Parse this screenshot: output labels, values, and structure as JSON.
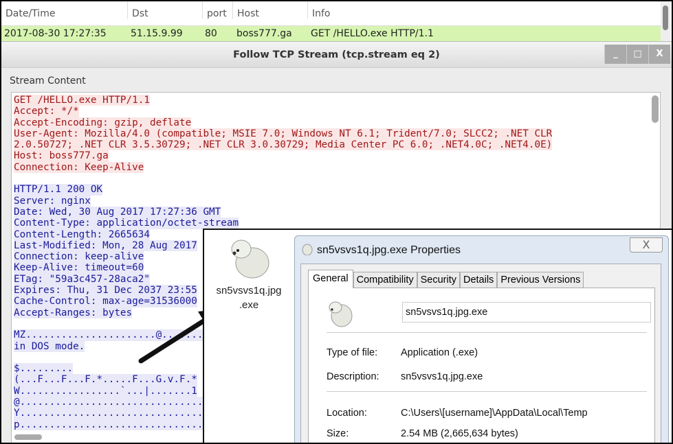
{
  "packet_list": {
    "columns": [
      "Date/Time",
      "Dst",
      "port",
      "Host",
      "Info"
    ],
    "row": [
      "2017-08-30 17:27:35",
      "51.15.9.99",
      "80",
      "boss777.ga",
      "GET /HELLO.exe HTTP/1.1"
    ],
    "row_color": "#d7f5b0"
  },
  "tcp_window": {
    "title": "Follow TCP Stream (tcp.stream eq 2)",
    "buttons": [
      "_",
      "□",
      "X"
    ],
    "stream_label": "Stream Content",
    "client_lines": [
      "GET /HELLO.exe HTTP/1.1",
      "Accept: */*",
      "Accept-Encoding: gzip, deflate",
      "User-Agent: Mozilla/4.0 (compatible; MSIE 7.0; Windows NT 6.1; Trident/7.0; SLCC2; .NET CLR",
      "2.0.50727; .NET CLR 3.5.30729; .NET CLR 3.0.30729; Media Center PC 6.0; .NET4.0C; .NET4.0E)",
      "Host: boss777.ga",
      "Connection: Keep-Alive"
    ],
    "server_lines": [
      "HTTP/1.1 200 OK",
      "Server: nginx",
      "Date: Wed, 30 Aug 2017 17:27:36 GMT",
      "Content-Type: application/octet-stream",
      "Content-Length: 2665634",
      "Last-Modified: Mon, 28 Aug 2017",
      "Connection: keep-alive",
      "Keep-Alive: timeout=60",
      "ETag: \"59a3c457-28aca2\"",
      "Expires: Thu, 31 Dec 2037 23:55",
      "Cache-Control: max-age=31536000",
      "Accept-Ranges: bytes"
    ],
    "binary_lines_1": [
      "MZ......................@.......",
      "in DOS mode."
    ],
    "binary_lines_2": [
      "$.........",
      "(...F...F...F.*.....F...G.v.F.*",
      "W.................`...|.......1",
      "@...............................",
      "Y...............................",
      "p..............................."
    ],
    "client_color": "#a01818",
    "server_color": "#1a1a9a"
  },
  "file_icon": {
    "label_line1": "sn5vsvs1q.jpg",
    "label_line2": ".exe"
  },
  "properties": {
    "title": "sn5vsvs1q.jpg.exe Properties",
    "close": "X",
    "tabs": [
      "General",
      "Compatibility",
      "Security",
      "Details",
      "Previous Versions"
    ],
    "active_tab": "General",
    "filename": "sn5vsvs1q.jpg.exe",
    "fields": [
      {
        "label": "Type of file:",
        "value": "Application (.exe)"
      },
      {
        "label": "Description:",
        "value": "sn5vsvs1q.jpg.exe"
      },
      {
        "label": "Location:",
        "value": "C:\\Users\\[username]\\AppData\\Local\\Temp"
      },
      {
        "label": "Size:",
        "value": "2.54 MB (2,665,634 bytes)"
      }
    ]
  }
}
